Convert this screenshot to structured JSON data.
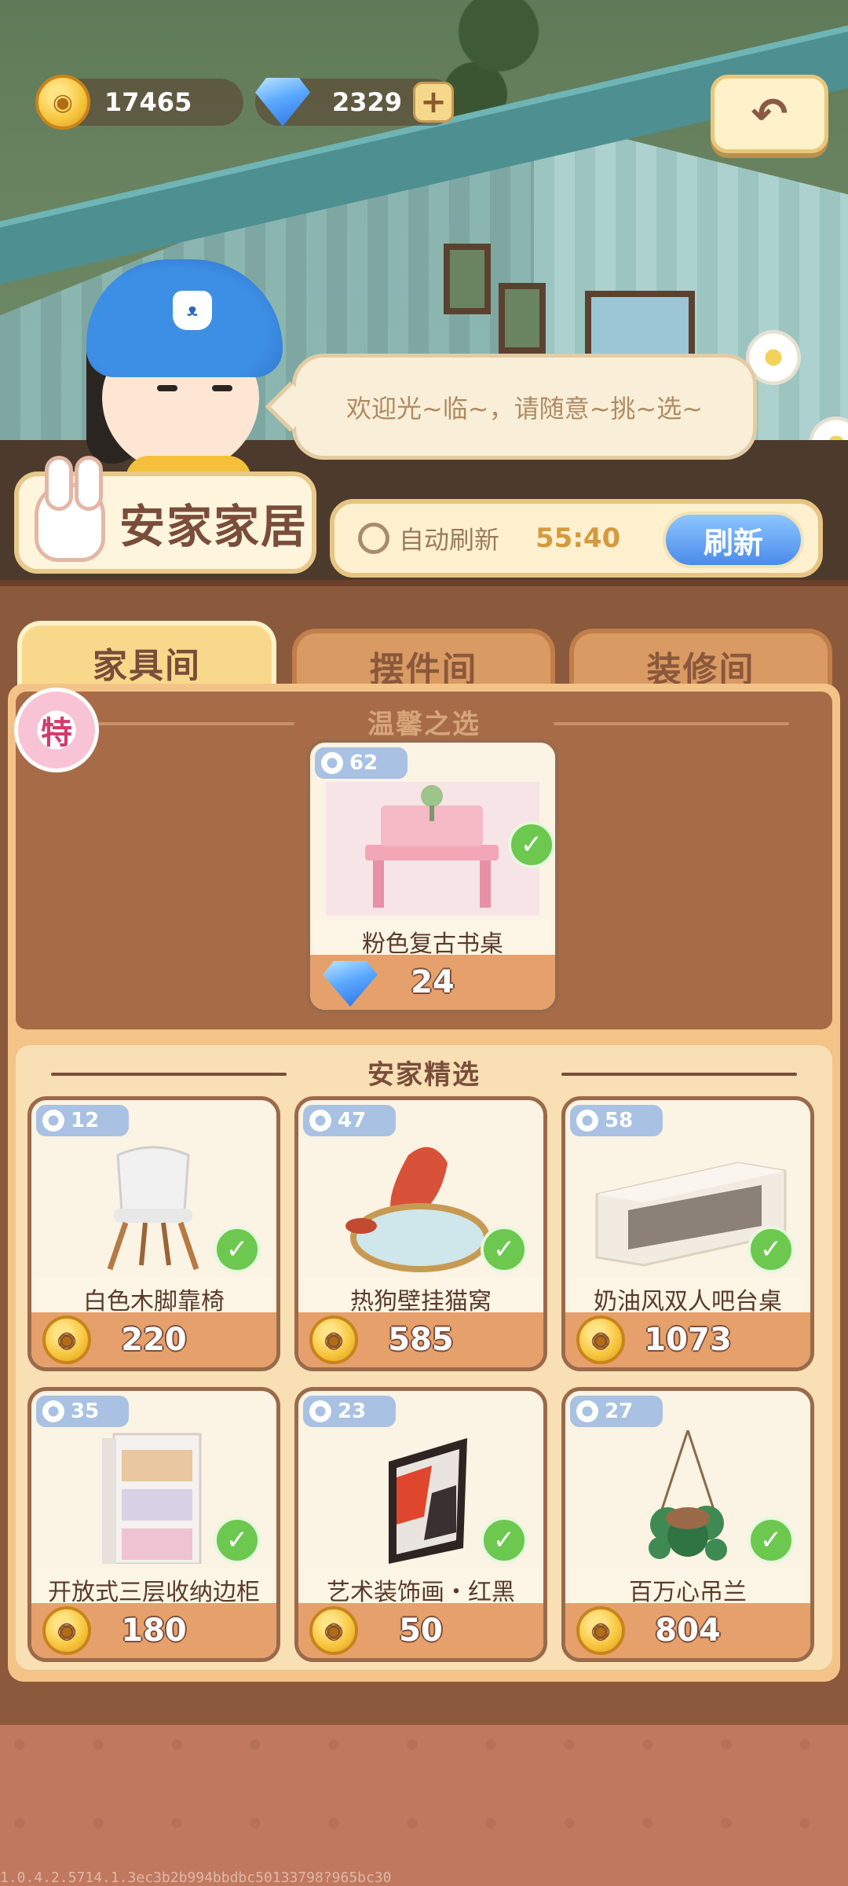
{
  "currency": {
    "coins": "17465",
    "gems": "2329",
    "plus_label": "+"
  },
  "dialog": {
    "text": "欢迎光~临~，请随意~挑~选~"
  },
  "shop": {
    "name": "安家家居"
  },
  "refresh": {
    "label": "自动刷新",
    "timer": "55:40",
    "button_label": "刷新"
  },
  "tabs": [
    {
      "label": "家具间",
      "active": true
    },
    {
      "label": "摆件间",
      "active": false
    },
    {
      "label": "装修间",
      "active": false
    }
  ],
  "special": {
    "tag": "特",
    "section_title": "温馨之选",
    "item": {
      "level": "62",
      "name": "粉色复古书桌",
      "price": "24",
      "currency": "gem"
    }
  },
  "curated": {
    "section_title": "安家精选",
    "items": [
      {
        "level": "12",
        "name": "白色木脚靠椅",
        "price": "220"
      },
      {
        "level": "47",
        "name": "热狗壁挂猫窝",
        "price": "585"
      },
      {
        "level": "58",
        "name": "奶油风双人吧台桌",
        "price": "1073"
      },
      {
        "level": "35",
        "name": "开放式三层收纳边柜",
        "price": "180"
      },
      {
        "level": "23",
        "name": "艺术装饰画・红黑",
        "price": "50"
      },
      {
        "level": "27",
        "name": "百万心吊兰",
        "price": "804"
      }
    ]
  },
  "footer": {
    "build": "1.0.4.2.5714.1.3ec3b2b994bbdbc50133798?965bc30"
  }
}
